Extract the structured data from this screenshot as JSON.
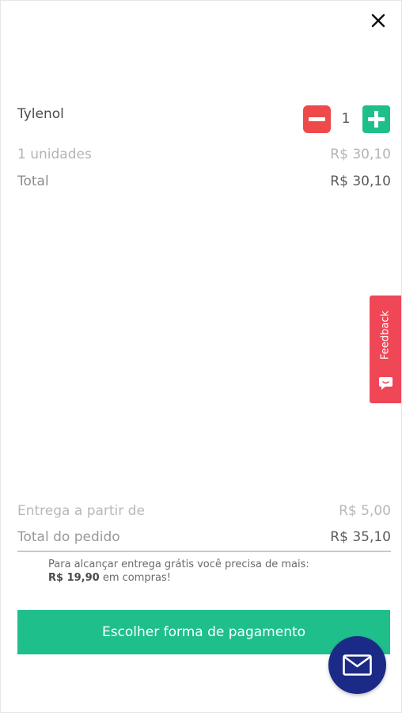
{
  "close": {
    "icon": "close-icon"
  },
  "product": {
    "name": "Tylenol",
    "quantity": "1",
    "minus_icon": "minus-icon",
    "plus_icon": "plus-icon"
  },
  "summary": {
    "units_label": "1 unidades",
    "units_value": "R$ 30,10",
    "total_label": "Total",
    "total_value": "R$ 30,10"
  },
  "feedback": {
    "label": "Feedback",
    "icon": "chat-bubble-icon"
  },
  "order": {
    "delivery_label": "Entrega a partir de",
    "delivery_value": "R$ 5,00",
    "order_total_label": "Total do pedido",
    "order_total_value": "R$ 35,10",
    "free_shipping_note_line1": "Para alcançar entrega grátis você precisa de mais:",
    "free_shipping_amount": "R$ 19,90",
    "free_shipping_note_suffix": " em compras!"
  },
  "actions": {
    "pay_button_label": "Escolher forma de pagamento",
    "mail_icon": "mail-icon"
  },
  "colors": {
    "accent_green": "#1fbf8c",
    "minus_red": "#ef4a4a",
    "feedback_red": "#ef4756",
    "fab_navy": "#1b2a86"
  }
}
